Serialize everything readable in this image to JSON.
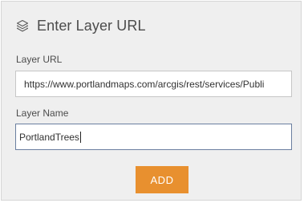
{
  "header": {
    "title": "Enter Layer URL",
    "icon": "layers-icon"
  },
  "form": {
    "url_label": "Layer URL",
    "url_value": "https://www.portlandmaps.com/arcgis/rest/services/Publi",
    "name_label": "Layer Name",
    "name_value": "PortlandTrees"
  },
  "actions": {
    "add_label": "ADD"
  },
  "colors": {
    "panel_bg": "#efefef",
    "accent": "#e8902f",
    "text": "#4c4c4c"
  }
}
